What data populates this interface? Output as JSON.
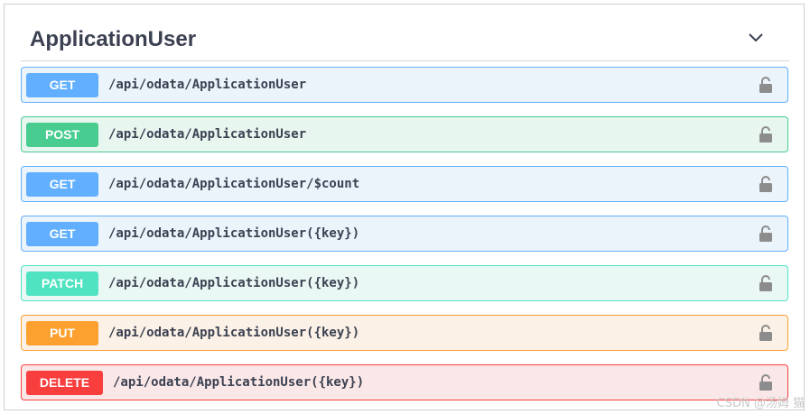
{
  "section": {
    "title": "ApplicationUser"
  },
  "operations": [
    {
      "method": "GET",
      "path": "/api/odata/ApplicationUser",
      "color": "#61affe",
      "bg": "#ebf3fb"
    },
    {
      "method": "POST",
      "path": "/api/odata/ApplicationUser",
      "color": "#49cc90",
      "bg": "#e8f6f0"
    },
    {
      "method": "GET",
      "path": "/api/odata/ApplicationUser/$count",
      "color": "#61affe",
      "bg": "#ebf3fb"
    },
    {
      "method": "GET",
      "path": "/api/odata/ApplicationUser({key})",
      "color": "#61affe",
      "bg": "#ebf3fb"
    },
    {
      "method": "PATCH",
      "path": "/api/odata/ApplicationUser({key})",
      "color": "#50e3c2",
      "bg": "#e9f8f5"
    },
    {
      "method": "PUT",
      "path": "/api/odata/ApplicationUser({key})",
      "color": "#fca130",
      "bg": "#fbf1e6"
    },
    {
      "method": "DELETE",
      "path": "/api/odata/ApplicationUser({key})",
      "color": "#f93e3e",
      "bg": "#fae7e7"
    }
  ],
  "icons": {
    "collapse": "chevron-down-icon",
    "auth": "lock-icon"
  },
  "watermark": "CSDN @汤姆 猫"
}
